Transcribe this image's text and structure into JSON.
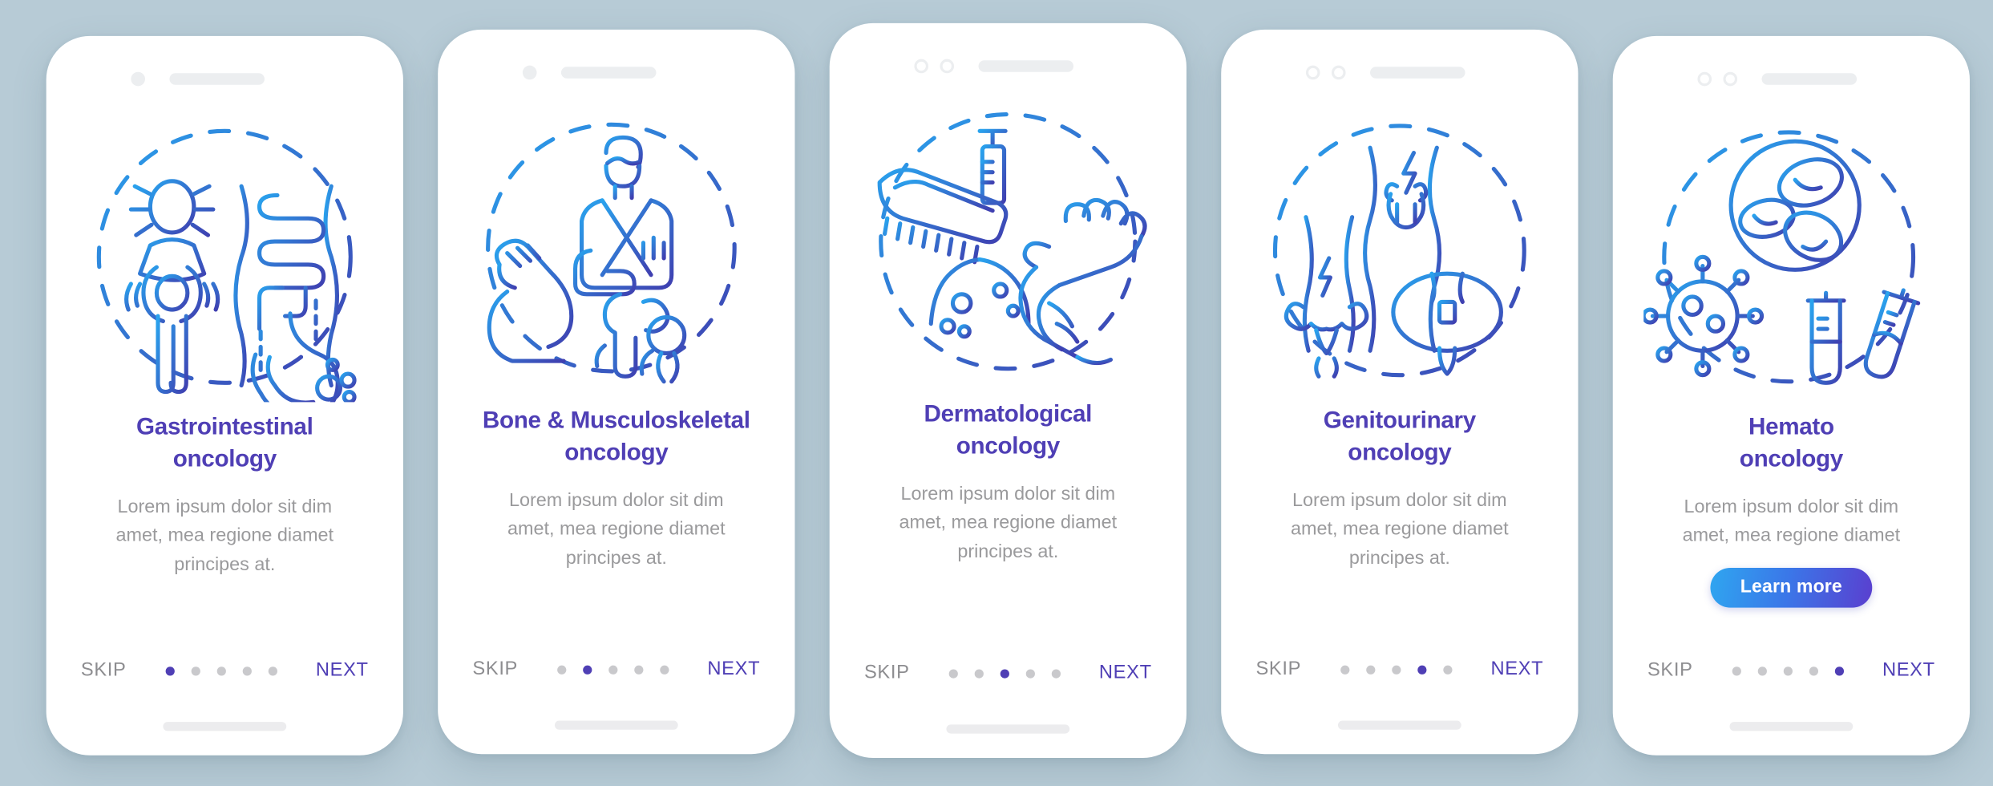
{
  "background_color": "#b7cbd6",
  "theme": {
    "title_color": "#4f3fb5",
    "body_color": "#9a9a9c",
    "skip_color": "#8d8d90",
    "next_color": "#4f3fb5",
    "dot_active_color": "#4f3fb5",
    "dot_inactive_color": "#c9c9cc",
    "illustration_gradient_from": "#2196f3",
    "illustration_gradient_to": "#3f3fb0",
    "cta_gradient_from": "#2fa6f0",
    "cta_gradient_to": "#5a3fcf"
  },
  "nav": {
    "skip_label": "SKIP",
    "next_label": "NEXT",
    "total_steps": 5
  },
  "screens": [
    {
      "id": "gastrointestinal-oncology",
      "status_bar": {
        "camera_style": "single-dot",
        "speaker": true
      },
      "illustration": "gastrointestinal-oncology-illustration",
      "title_line1": "Gastrointestinal",
      "title_line2": "oncology",
      "description_line1": "Lorem ipsum dolor sit dim",
      "description_line2": "amet, mea regione diamet",
      "description_line3": "principes at.",
      "cta": null,
      "active_step": 1
    },
    {
      "id": "bone-musculoskeletal-oncology",
      "status_bar": {
        "camera_style": "single-dot",
        "speaker": true
      },
      "illustration": "bone-musculoskeletal-oncology-illustration",
      "title_line1": "Bone & Musculoskeletal",
      "title_line2": "oncology",
      "description_line1": "Lorem ipsum dolor sit dim",
      "description_line2": "amet, mea regione diamet",
      "description_line3": "principes at.",
      "cta": null,
      "active_step": 2
    },
    {
      "id": "dermatological-oncology",
      "status_bar": {
        "camera_style": "double-ring",
        "speaker": true
      },
      "illustration": "dermatological-oncology-illustration",
      "title_line1": "Dermatological",
      "title_line2": "oncology",
      "description_line1": "Lorem ipsum dolor sit dim",
      "description_line2": "amet, mea regione diamet",
      "description_line3": "principes at.",
      "cta": null,
      "active_step": 3
    },
    {
      "id": "genitourinary-oncology",
      "status_bar": {
        "camera_style": "double-ring",
        "speaker": true
      },
      "illustration": "genitourinary-oncology-illustration",
      "title_line1": "Genitourinary",
      "title_line2": "oncology",
      "description_line1": "Lorem ipsum dolor sit dim",
      "description_line2": "amet, mea regione diamet",
      "description_line3": "principes at.",
      "cta": null,
      "active_step": 4
    },
    {
      "id": "hemato-oncology",
      "status_bar": {
        "camera_style": "double-ring",
        "speaker": true
      },
      "illustration": "hemato-oncology-illustration",
      "title_line1": "Hemato",
      "title_line2": "oncology",
      "description_line1": "Lorem ipsum dolor sit dim",
      "description_line2": "amet, mea regione diamet",
      "description_line3": "",
      "cta": "Learn more",
      "active_step": 5
    }
  ]
}
